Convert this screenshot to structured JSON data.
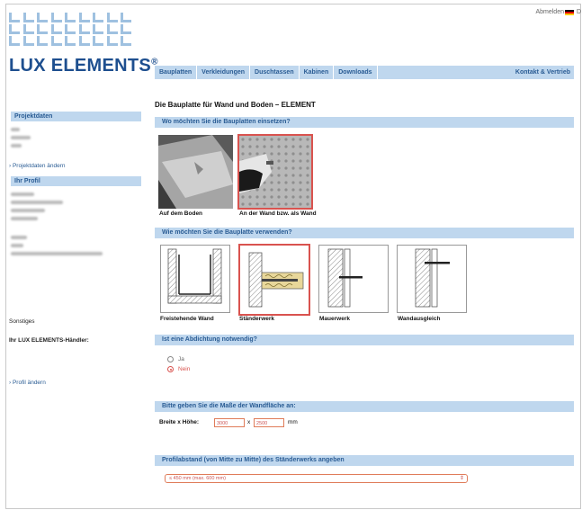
{
  "brand": {
    "name": "LUX ELEMENTS",
    "mark": "®"
  },
  "topbar": {
    "logout": "Abmelden",
    "lang": "D"
  },
  "nav": {
    "items": [
      "Bauplatten",
      "Verkleidungen",
      "Duschtassen",
      "Kabinen",
      "Downloads"
    ],
    "right": "Kontakt & Vertrieb"
  },
  "sidebar": {
    "project_heading": "Projektdaten",
    "project_link": "› Projektdaten ändern",
    "profile_heading": "Ihr Profil",
    "misc_label": "Sonstiges",
    "dealer_label": "Ihr LUX ELEMENTS-Händler:",
    "profile_link": "› Profil ändern"
  },
  "main": {
    "title": "Die Bauplatte für Wand und Boden – ELEMENT",
    "q1": "Wo möchten Sie die Bauplatten einsetzen?",
    "q1_options": [
      "Auf dem Boden",
      "An der Wand bzw. als Wand"
    ],
    "q1_selected": 1,
    "q2": "Wie möchten Sie die Bauplatte verwenden?",
    "q2_options": [
      "Freistehende Wand",
      "Ständerwerk",
      "Mauerwerk",
      "Wandausgleich"
    ],
    "q2_selected": 1,
    "q3": "Ist eine Abdichtung notwendig?",
    "q3_yes": "Ja",
    "q3_no": "Nein",
    "q3_selected": "no",
    "q4": "Bitte geben Sie die Maße der Wandfläche an:",
    "dims_label": "Breite x Höhe:",
    "width": "3000",
    "times": "x",
    "height": "2500",
    "unit": "mm",
    "q5": "Profilabstand (von Mitte zu Mitte) des Ständerwerks angeben",
    "spacing_value": "≤ 450 mm (max. 600 mm)"
  },
  "colors": {
    "accent_bar": "#bfd7ee",
    "link": "#2a5c94",
    "selected": "#d9534f"
  }
}
